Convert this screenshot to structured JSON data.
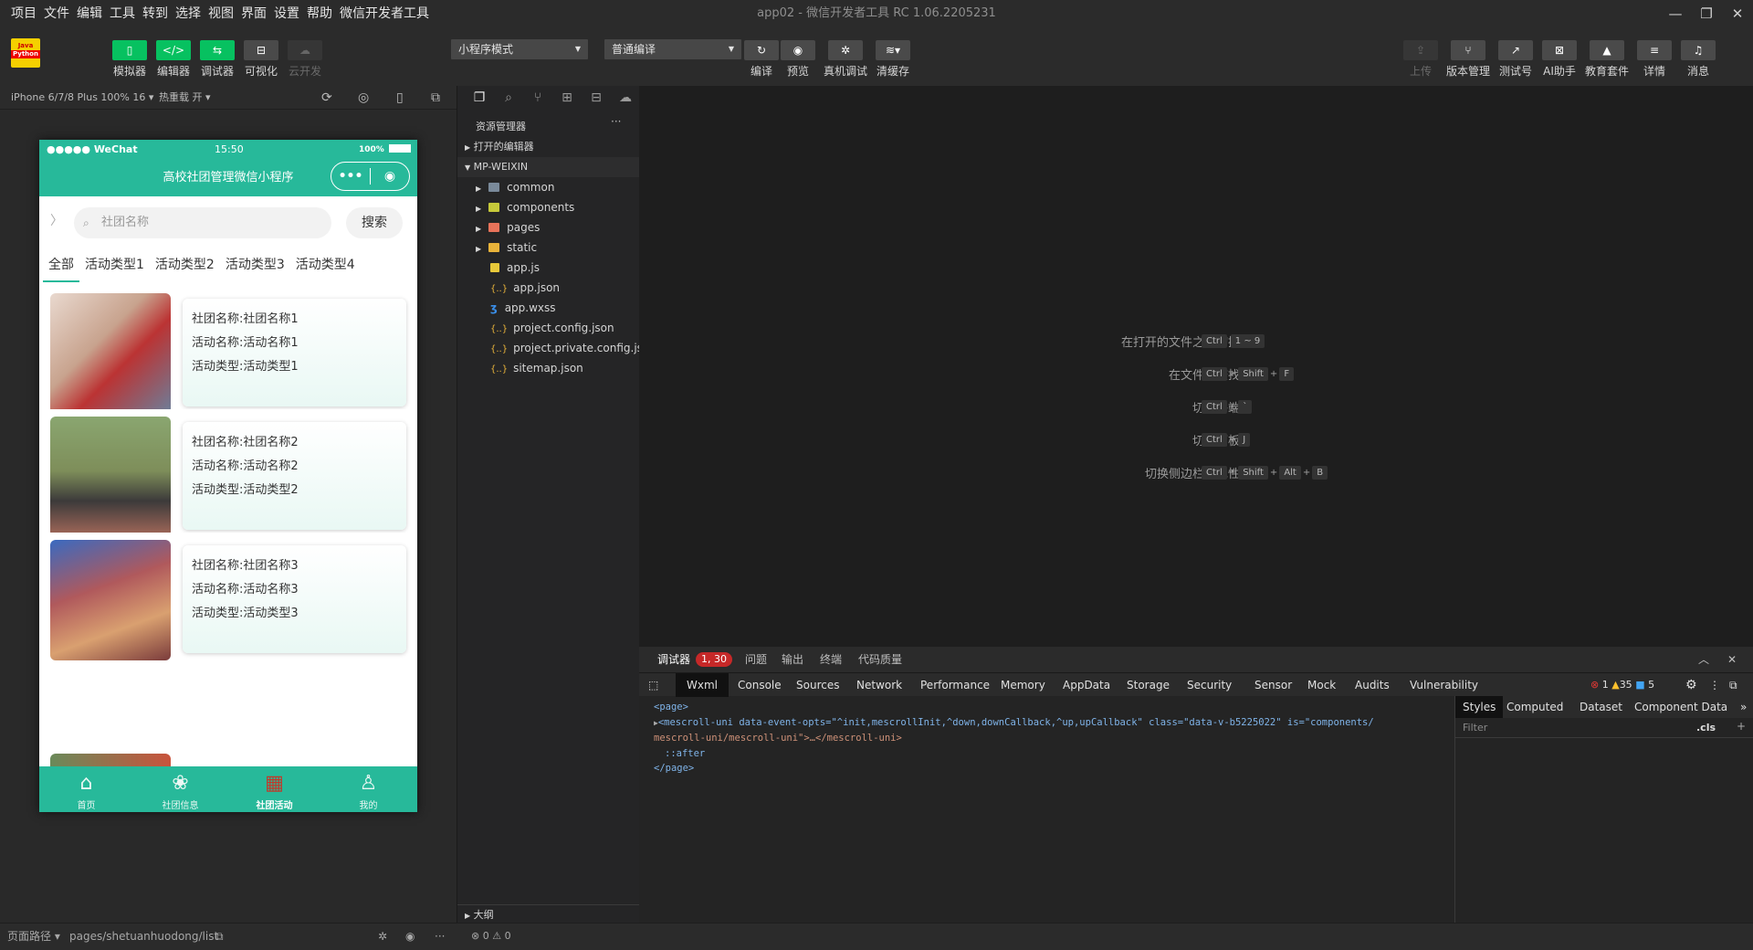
{
  "menu": [
    "项目",
    "文件",
    "编辑",
    "工具",
    "转到",
    "选择",
    "视图",
    "界面",
    "设置",
    "帮助",
    "微信开发者工具"
  ],
  "window_title": "app02 - 微信开发者工具 RC 1.06.2205231",
  "logo": {
    "line1": "Java",
    "line2": "Python"
  },
  "toolbar": {
    "left": [
      {
        "label": "模拟器",
        "icon": "phone-icon"
      },
      {
        "label": "编辑器",
        "icon": "code-icon"
      },
      {
        "label": "调试器",
        "icon": "debug-icon"
      },
      {
        "label": "可视化",
        "icon": "layout-icon"
      },
      {
        "label": "云开发",
        "icon": "cloud-icon"
      }
    ],
    "mode_select": "小程序模式",
    "compile_select": "普通编译",
    "mid": [
      {
        "label": "编译",
        "icon": "refresh-icon"
      },
      {
        "label": "预览",
        "icon": "eye-icon"
      },
      {
        "label": "真机调试",
        "icon": "bug-icon"
      },
      {
        "label": "清缓存",
        "icon": "layers-icon"
      }
    ],
    "right": [
      {
        "label": "上传",
        "icon": "upload-icon"
      },
      {
        "label": "版本管理",
        "icon": "branch-icon"
      },
      {
        "label": "测试号",
        "icon": "external-icon"
      },
      {
        "label": "AI助手",
        "icon": "ai-icon"
      },
      {
        "label": "教育套件",
        "icon": "grad-icon"
      },
      {
        "label": "详情",
        "icon": "menu-icon"
      },
      {
        "label": "消息",
        "icon": "bell-icon"
      }
    ]
  },
  "simulator": {
    "device": "iPhone 6/7/8 Plus 100% 16",
    "hot_reload": "热重载 开",
    "status": {
      "carrier": "●●●●● WeChat",
      "time": "15:50",
      "battery": "100%"
    },
    "nav_title": "高校社团管理微信小程序",
    "search": {
      "placeholder": "社团名称",
      "button": "搜索"
    },
    "tabs": [
      "全部",
      "活动类型1",
      "活动类型2",
      "活动类型3",
      "活动类型4"
    ],
    "cards": [
      {
        "line1": "社团名称:社团名称1",
        "line2": "活动名称:活动名称1",
        "line3": "活动类型:活动类型1",
        "img": "#c8a38e"
      },
      {
        "line1": "社团名称:社团名称2",
        "line2": "活动名称:活动名称2",
        "line3": "活动类型:活动类型2",
        "img": "#7e8e5a"
      },
      {
        "line1": "社团名称:社团名称3",
        "line2": "活动名称:活动名称3",
        "line3": "活动类型:活动类型3",
        "img": "#b0595c"
      }
    ],
    "tabbar": [
      {
        "label": "首页",
        "icon": "home-icon"
      },
      {
        "label": "社团信息",
        "icon": "grid-icon"
      },
      {
        "label": "社团活动",
        "icon": "calendar-icon"
      },
      {
        "label": "我的",
        "icon": "user-icon"
      }
    ]
  },
  "explorer": {
    "title": "资源管理器",
    "open_editors": "打开的编辑器",
    "root": "MP-WEIXIN",
    "items": [
      {
        "name": "common",
        "type": "folder",
        "color": "#7a8a9a"
      },
      {
        "name": "components",
        "type": "folder",
        "color": "#c6c93a"
      },
      {
        "name": "pages",
        "type": "folder",
        "color": "#e8735a"
      },
      {
        "name": "static",
        "type": "folder",
        "color": "#e8b33a"
      },
      {
        "name": "app.js",
        "type": "file",
        "color": "#e8c93a"
      },
      {
        "name": "app.json",
        "type": "file",
        "color": "#e8b33a"
      },
      {
        "name": "app.wxss",
        "type": "file",
        "color": "#3a8ee8"
      },
      {
        "name": "project.config.json",
        "type": "file",
        "color": "#e8b33a"
      },
      {
        "name": "project.private.config.js...",
        "type": "file",
        "color": "#e8b33a"
      },
      {
        "name": "sitemap.json",
        "type": "file",
        "color": "#e8b33a"
      }
    ],
    "outline": "大纲"
  },
  "shortcuts": [
    {
      "label": "在打开的文件之间切换",
      "keys": [
        "Ctrl",
        "1 ~ 9"
      ]
    },
    {
      "label": "在文件中查找",
      "keys": [
        "Ctrl",
        "+",
        "Shift",
        "+",
        "F"
      ]
    },
    {
      "label": "切换终端",
      "keys": [
        "Ctrl",
        "+",
        "`"
      ]
    },
    {
      "label": "切换面板",
      "keys": [
        "Ctrl",
        "+",
        "J"
      ]
    },
    {
      "label": "切换侧边栏可见性",
      "keys": [
        "Ctrl",
        "+",
        "Shift",
        "+",
        "Alt",
        "+",
        "B"
      ]
    }
  ],
  "devtools": {
    "top_tabs": [
      "调试器",
      "问题",
      "输出",
      "终端",
      "代码质量"
    ],
    "badge": "1, 30",
    "tabs": [
      "Wxml",
      "Console",
      "Sources",
      "Network",
      "Performance",
      "Memory",
      "AppData",
      "Storage",
      "Security",
      "Sensor",
      "Mock",
      "Audits",
      "Vulnerability"
    ],
    "counts": {
      "errors": "1",
      "warnings": "35",
      "info": "5"
    },
    "code": [
      "<page>",
      "<mescroll-uni data-event-opts=\"^init,mescrollInit,^down,downCallback,^up,upCallback\" class=\"data-v-b5225022\" is=\"components/",
      "mescroll-uni/mescroll-uni\">…</mescroll-uni>",
      "::after",
      "</page>"
    ],
    "style_tabs": [
      "Styles",
      "Computed",
      "Dataset",
      "Component Data"
    ],
    "filter_placeholder": "Filter",
    "cls": ".cls"
  },
  "statusbar": {
    "path_label": "页面路径",
    "path": "pages/shetuanhuodong/list",
    "errors": "0",
    "warnings": "0"
  }
}
